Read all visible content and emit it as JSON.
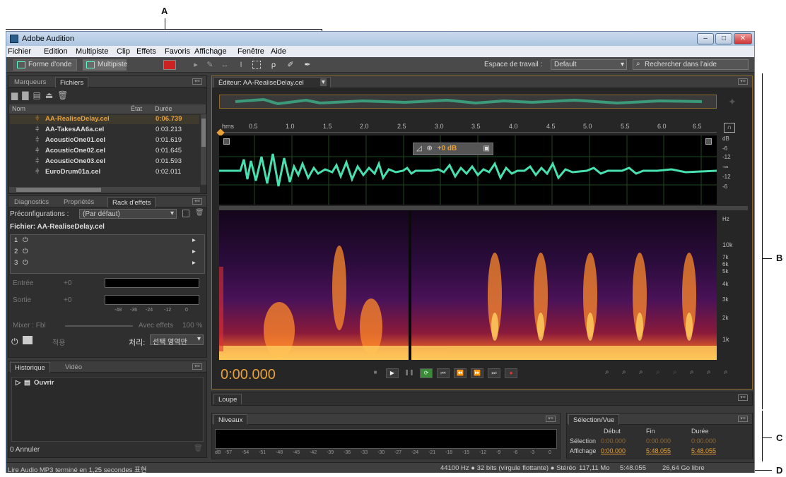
{
  "callouts": {
    "a": "A",
    "b": "B",
    "c": "C",
    "d": "D"
  },
  "window": {
    "title": "Adobe Audition",
    "min": "–",
    "max": "□",
    "close": "✕"
  },
  "menu": [
    "Fichier",
    "Edition",
    "Multipiste",
    "Clip",
    "Effets",
    "Favoris",
    "Affichage",
    "Fenêtre",
    "Aide"
  ],
  "toolbar": {
    "waveform": "Forme d'onde",
    "multitrack": "Multipiste",
    "workspace_label": "Espace de travail :",
    "workspace_value": "Default",
    "search_placeholder": "Rechercher dans l'aide"
  },
  "files_panel": {
    "tabs": [
      "Marqueurs",
      "Fichiers"
    ],
    "headers": {
      "name": "Nom",
      "state": "État",
      "duration": "Durée"
    },
    "rows": [
      {
        "name": "AA-RealiseDelay.cel",
        "duration": "0:06.739"
      },
      {
        "name": "AA-TakesAA6a.cel",
        "duration": "0:03.213"
      },
      {
        "name": "AcousticOne01.cel",
        "duration": "0:01.619"
      },
      {
        "name": "AcousticOne02.cel",
        "duration": "0:01.645"
      },
      {
        "name": "AcousticOne03.cel",
        "duration": "0:01.593"
      },
      {
        "name": "EuroDrum01a.cel",
        "duration": "0:02.011"
      }
    ]
  },
  "rack_panel": {
    "tabs": [
      "Diagnostics",
      "Propriétés",
      "Rack d'effets"
    ],
    "presets_label": "Préconfigurations :",
    "presets_value": "(Par défaut)",
    "file_label": "Fichier: AA-RealiseDelay.cel",
    "slots": [
      "1",
      "2",
      "3"
    ],
    "input_label": "Entrée",
    "output_label": "Sortie",
    "gain": "+0",
    "meter_scale": [
      "-48",
      "-36",
      "-24",
      "-12",
      "0"
    ],
    "mix_label": "Mixer : Fbl",
    "mix_right": "Avec effets",
    "mix_pct": "100 %",
    "apply": "적용",
    "process_label": "처리:",
    "process_value": "선택 영역만"
  },
  "history_panel": {
    "tabs": [
      "Historique",
      "Vidéo"
    ],
    "item": "Ouvrir",
    "undo": "0 Annuler"
  },
  "editor": {
    "tab": "Éditeur: AA-RealiseDelay.cel",
    "ruler": [
      "hms",
      "0.5",
      "1.0",
      "1.5",
      "2.0",
      "2.5",
      "3.0",
      "3.5",
      "4.0",
      "4.5",
      "5.0",
      "5.5",
      "6.0",
      "6.5"
    ],
    "hud_gain": "+0 dB",
    "db_scale": [
      "dB",
      "-6",
      "-12",
      "-∞",
      "-12",
      "-6"
    ],
    "hz_scale": [
      "Hz",
      "10k",
      "7k",
      "6k",
      "5k",
      "4k",
      "3k",
      "2k",
      "1k"
    ],
    "time": "0:00.000"
  },
  "loupe": {
    "tab": "Loupe"
  },
  "levels": {
    "tab": "Niveaux",
    "scale": [
      "dB",
      "-57",
      "-54",
      "-51",
      "-48",
      "-45",
      "-42",
      "-39",
      "-36",
      "-33",
      "-30",
      "-27",
      "-24",
      "-21",
      "-18",
      "-15",
      "-12",
      "-9",
      "-6",
      "-3",
      "0"
    ]
  },
  "selection": {
    "tab": "Sélection/Vue",
    "headers": [
      "Début",
      "Fin",
      "Durée"
    ],
    "selection_label": "Sélection",
    "selection_vals": [
      "0:00.000",
      "0:00.000",
      "0:00.000"
    ],
    "view_label": "Affichage",
    "view_vals": [
      "0:00.000",
      "5:48.055",
      "5:48.055"
    ]
  },
  "status": {
    "left": "Lire Audio MP3 terminé en 1,25 secondes 표현",
    "format": "44100 Hz ● 32 bits (virgule flottante) ● Stéréo",
    "size": "117,11 Mo",
    "duration": "5:48.055",
    "free": "26,64 Go libre"
  }
}
